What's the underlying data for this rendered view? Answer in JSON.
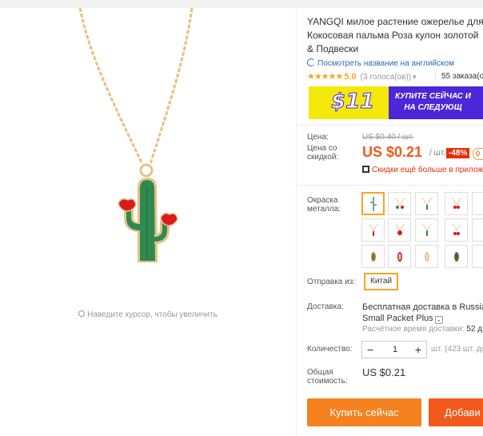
{
  "product": {
    "title_lines": [
      "YANGQI милое растение ожерелье для",
      "Кокосовая пальма Роза кулон золотой",
      "& Подвески"
    ],
    "translate_link": "Посмотреть название на английском",
    "rating": {
      "stars": "★★★★★",
      "score": "5.0",
      "votes": "(3 голоса(ов))",
      "chevron": "▾"
    },
    "orders": "55 заказа(ов)"
  },
  "banner": {
    "amount": "$11",
    "promo_line1": "КУПИТЕ СЕЙЧАС И",
    "promo_line2": "НА СЛЕДУЮЩ"
  },
  "price": {
    "label": "Цена:",
    "old": "US $0.40 / шт.",
    "discount_label": "Цена со скидкой:",
    "new": "US $0.21",
    "per": "/ шт.",
    "percent": "-48%",
    "coupon_fragment": "0",
    "app_discount": "Скидки ещё больше в приложе"
  },
  "options": {
    "color_label": "Окраска металла:",
    "ship_from_label": "Отправка из:",
    "ship_from_value": "Китай"
  },
  "delivery": {
    "label": "Доставка:",
    "line1": "Бесплатная доставка в Russian",
    "line2": "Small Packet Plus",
    "time_label": "Расчётное время доставки:",
    "time_value": "52 д"
  },
  "quantity": {
    "label": "Количество:",
    "minus": "−",
    "value": "1",
    "plus": "+",
    "stock": "шт. (423 шт. до"
  },
  "total": {
    "label": "Общая стоимость:",
    "value": "US $0.21"
  },
  "actions": {
    "buy": "Купить сейчас",
    "cart": "Добави"
  },
  "gallery": {
    "zoom_hint": "Наведите курсор, чтобы увеличить"
  },
  "colors": {
    "accent": "#f5821f",
    "price": "#f25a1c",
    "banner_purple": "#4b27d8",
    "banner_yellow": "#f4e80b",
    "cactus": "#2e8a4e",
    "gold": "#e8c088"
  }
}
